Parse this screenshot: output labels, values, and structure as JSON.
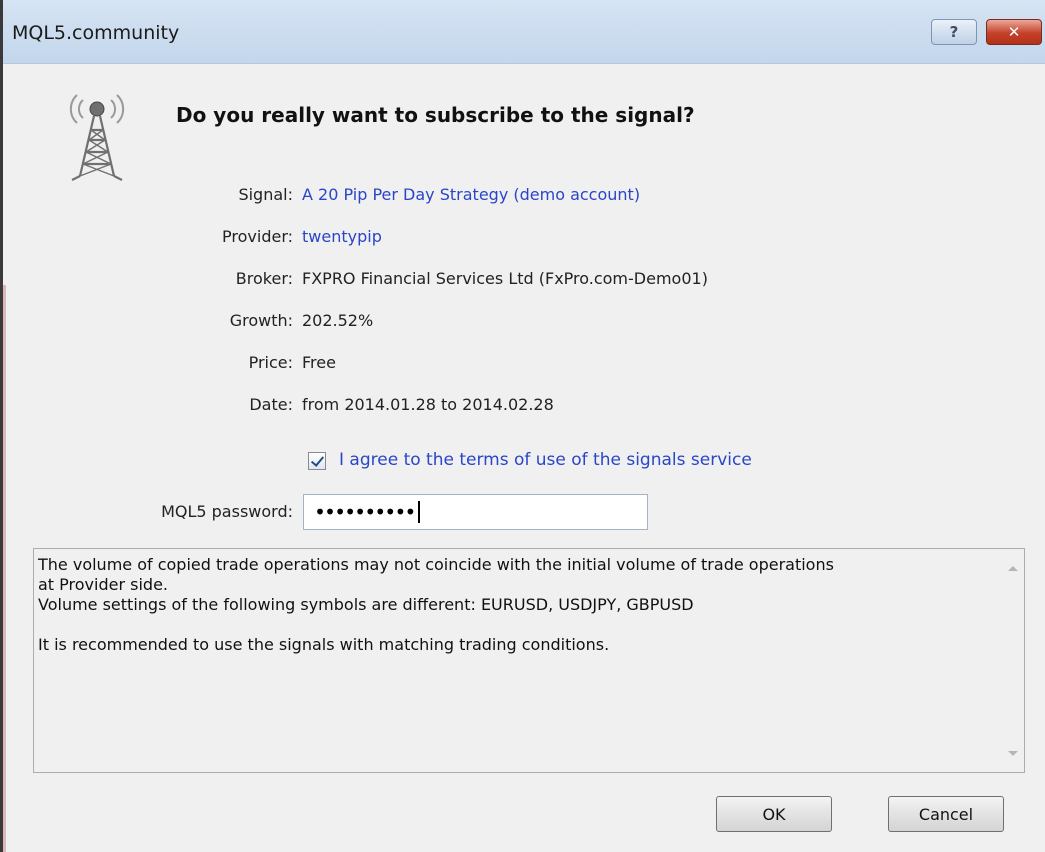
{
  "window": {
    "title": "MQL5.community",
    "help_label": "?",
    "close_label": "✕"
  },
  "dialog": {
    "question": "Do you really want to subscribe to the signal?",
    "icon": "signal-tower-icon"
  },
  "fields": [
    {
      "label": "Signal:",
      "value": "A 20 Pip Per Day Strategy (demo account)",
      "link": true
    },
    {
      "label": "Provider:",
      "value": "twentypip",
      "link": true
    },
    {
      "label": "Broker:",
      "value": "FXPRO Financial Services Ltd (FxPro.com-Demo01)",
      "link": false
    },
    {
      "label": "Growth:",
      "value": "202.52%",
      "link": false
    },
    {
      "label": "Price:",
      "value": "Free",
      "link": false
    },
    {
      "label": "Date:",
      "value": "from 2014.01.28 to 2014.02.28",
      "link": false
    }
  ],
  "agreement": {
    "checked": true,
    "label": "I agree to the terms of use of the signals service"
  },
  "password": {
    "label": "MQL5 password:",
    "value": "••••••••••"
  },
  "notice": {
    "text": "The volume of copied trade operations may not coincide with the initial volume of trade operations\nat Provider side.\nVolume settings of the following symbols are different: EURUSD, USDJPY, GBPUSD\n\nIt is recommended to use the signals with matching trading conditions."
  },
  "buttons": {
    "ok": "OK",
    "cancel": "Cancel"
  },
  "colors": {
    "link": "#2a45c8",
    "close_button": "#c5412a",
    "titlebar": "#c3d6ec"
  }
}
